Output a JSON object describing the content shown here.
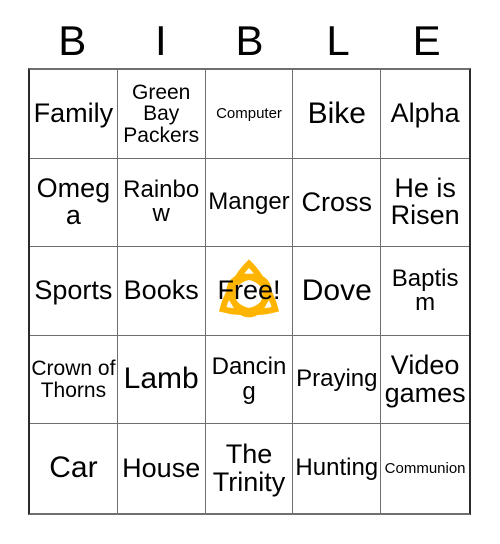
{
  "card": {
    "title": "BIBLE Bingo Card",
    "header_letters": [
      "B",
      "I",
      "B",
      "L",
      "E"
    ],
    "free_space": {
      "label": "Free!",
      "icon": "trinity-knot-icon",
      "icon_color": "#FFB400",
      "icon_highlight": "#FFD24D",
      "icon_shadow": "#F5A000"
    },
    "grid_size": "5x5",
    "colors": {
      "text": "#000000",
      "border": "#6e6e6e",
      "border_outer": "#2b2b2b",
      "background": "#ffffff",
      "accent": "#FFB400"
    },
    "rows": [
      [
        {
          "text": "Family",
          "size": "fs-lg"
        },
        {
          "text": "Green Bay Packers",
          "size": "fs-sm"
        },
        {
          "text": "Computer",
          "size": "fs-xs"
        },
        {
          "text": "Bike",
          "size": "fs-xl"
        },
        {
          "text": "Alpha",
          "size": "fs-lg"
        }
      ],
      [
        {
          "text": "Omega",
          "size": "fs-lg"
        },
        {
          "text": "Rainbow",
          "size": "fs-md"
        },
        {
          "text": "Manger",
          "size": "fs-md"
        },
        {
          "text": "Cross",
          "size": "fs-lg"
        },
        {
          "text": "He is Risen",
          "size": "fs-lg"
        }
      ],
      [
        {
          "text": "Sports",
          "size": "fs-lg"
        },
        {
          "text": "Books",
          "size": "fs-lg"
        },
        {
          "text": "Free!",
          "size": "fs-lg",
          "free": true
        },
        {
          "text": "Dove",
          "size": "fs-xl"
        },
        {
          "text": "Baptism",
          "size": "fs-md"
        }
      ],
      [
        {
          "text": "Crown of Thorns",
          "size": "fs-sm"
        },
        {
          "text": "Lamb",
          "size": "fs-xl"
        },
        {
          "text": "Dancing",
          "size": "fs-md"
        },
        {
          "text": "Praying",
          "size": "fs-md"
        },
        {
          "text": "Video games",
          "size": "fs-lg"
        }
      ],
      [
        {
          "text": "Car",
          "size": "fs-xl"
        },
        {
          "text": "House",
          "size": "fs-lg"
        },
        {
          "text": "The Trinity",
          "size": "fs-lg"
        },
        {
          "text": "Hunting",
          "size": "fs-md"
        },
        {
          "text": "Communion",
          "size": "fs-xs"
        }
      ]
    ]
  }
}
